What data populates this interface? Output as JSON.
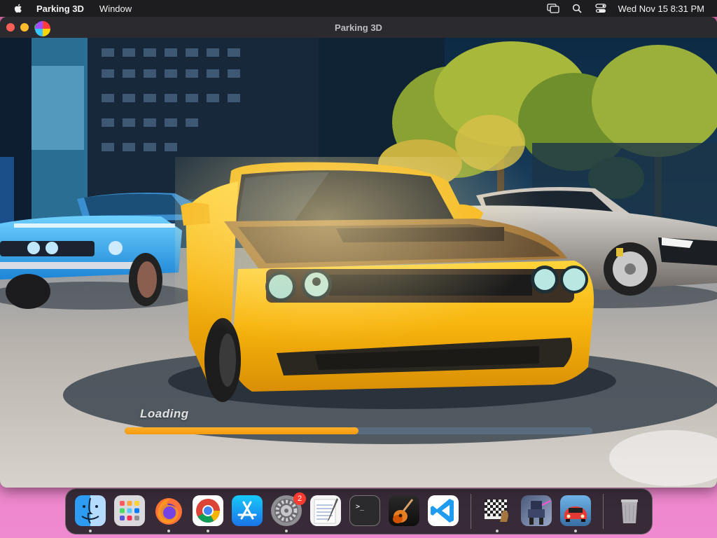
{
  "menubar": {
    "apple_icon": "apple-icon",
    "app_name": "Parking 3D",
    "menu_window": "Window",
    "clock": "Wed Nov 15  8:31 PM",
    "status_icons": [
      "screen-mirror-icon",
      "search-icon",
      "control-center-icon"
    ]
  },
  "window": {
    "title": "Parking 3D"
  },
  "game": {
    "loading_label": "Loading",
    "progress_fraction": 0.5,
    "accent_color": "#f5a011"
  },
  "dock": {
    "items": [
      {
        "name": "finder",
        "running": true
      },
      {
        "name": "launchpad",
        "running": false
      },
      {
        "name": "firefox",
        "running": true
      },
      {
        "name": "chrome",
        "running": true
      },
      {
        "name": "app-store",
        "running": false
      },
      {
        "name": "system-settings",
        "running": true,
        "badge": "2"
      },
      {
        "name": "textedit",
        "running": false
      },
      {
        "name": "terminal",
        "running": false
      },
      {
        "name": "garageband",
        "running": false
      },
      {
        "name": "vscode",
        "running": false
      }
    ],
    "recent": [
      {
        "name": "chess",
        "running": true
      },
      {
        "name": "mech-game",
        "running": false
      },
      {
        "name": "parking-3d",
        "running": true
      }
    ],
    "trash": "trash-icon"
  }
}
